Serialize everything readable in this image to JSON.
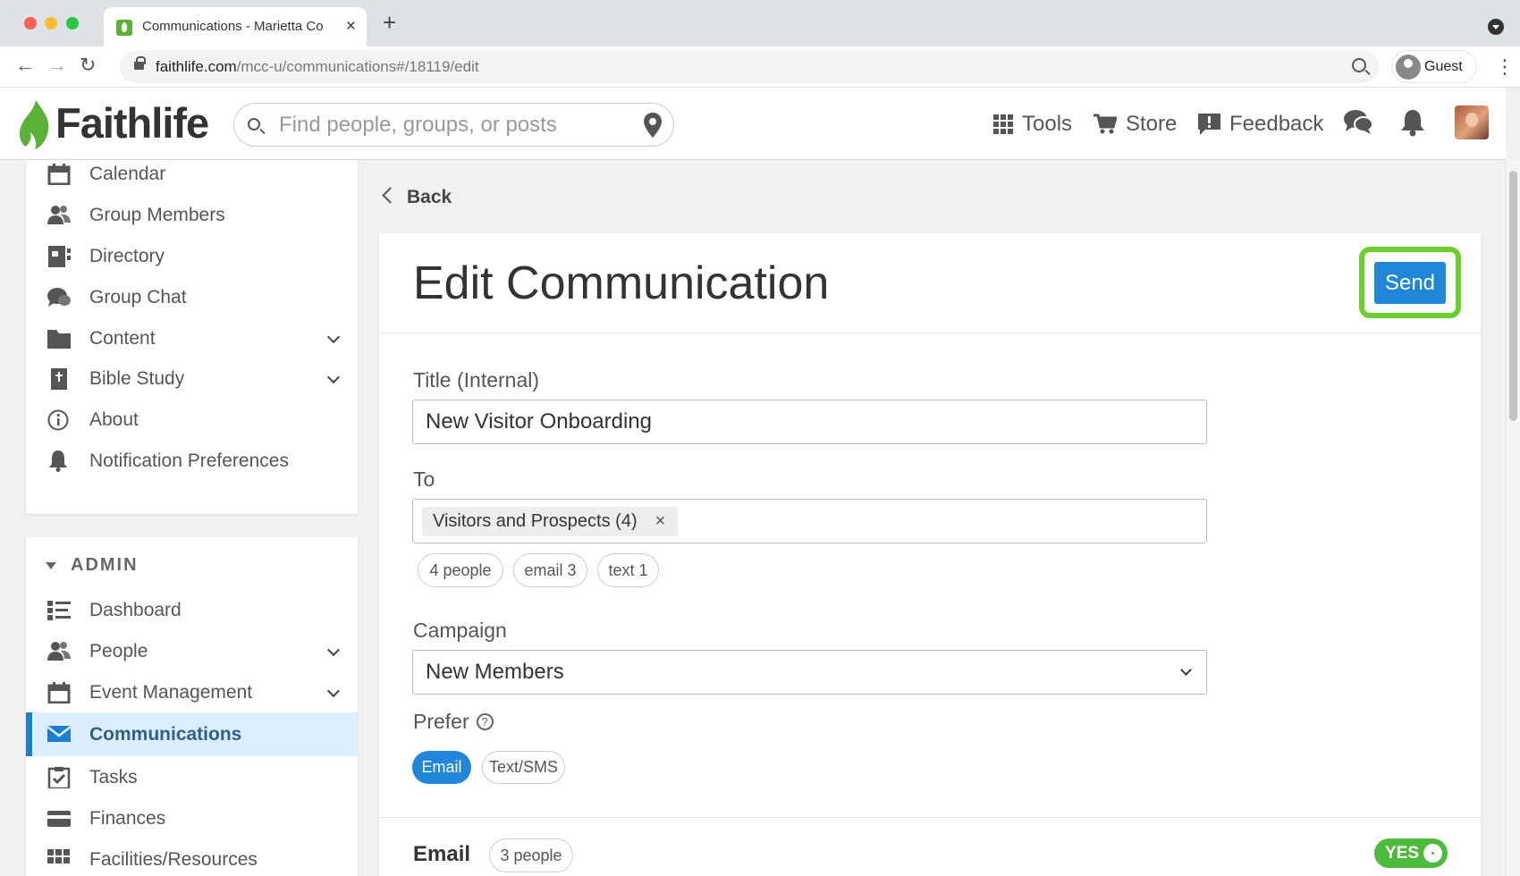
{
  "browser": {
    "tab_title": "Communications - Marietta Co",
    "tab_close": "×",
    "new_tab": "+",
    "url_host": "faithlife.com",
    "url_path": "/mcc-u/communications#/18119/edit",
    "profile_label": "Guest"
  },
  "header": {
    "logo_text": "Faithlife",
    "search_placeholder": "Find people, groups, or posts",
    "nav": {
      "tools": "Tools",
      "store": "Store",
      "feedback": "Feedback"
    }
  },
  "sidebar": {
    "items": [
      {
        "label": "Calendar",
        "icon": "calendar-icon"
      },
      {
        "label": "Group Members",
        "icon": "people-icon"
      },
      {
        "label": "Directory",
        "icon": "directory-icon"
      },
      {
        "label": "Group Chat",
        "icon": "chat-icon"
      },
      {
        "label": "Content",
        "icon": "folder-icon"
      },
      {
        "label": "Bible Study",
        "icon": "bible-icon"
      },
      {
        "label": "About",
        "icon": "info-icon"
      },
      {
        "label": "Notification Preferences",
        "icon": "bell-icon"
      }
    ],
    "admin_heading": "ADMIN",
    "admin_items": [
      {
        "label": "Dashboard",
        "icon": "dashboard-icon"
      },
      {
        "label": "People",
        "icon": "people-icon"
      },
      {
        "label": "Event Management",
        "icon": "calendar-icon"
      },
      {
        "label": "Communications",
        "icon": "envelope-icon"
      },
      {
        "label": "Tasks",
        "icon": "tasks-icon"
      },
      {
        "label": "Finances",
        "icon": "card-icon"
      },
      {
        "label": "Facilities/Resources",
        "icon": "grid-icon"
      }
    ]
  },
  "main": {
    "back_label": "Back",
    "title": "Edit Communication",
    "send_label": "Send",
    "title_field": {
      "label": "Title (Internal)",
      "value": "New Visitor Onboarding"
    },
    "to_field": {
      "label": "To",
      "recipient": "Visitors and Prospects (4)",
      "remove": "×",
      "counts": [
        "4 people",
        "email 3",
        "text 1"
      ]
    },
    "campaign": {
      "label": "Campaign",
      "value": "New Members"
    },
    "prefer": {
      "label": "Prefer",
      "help": "?",
      "options": [
        "Email",
        "Text/SMS"
      ],
      "selected": "Email"
    },
    "email_section": {
      "title": "Email",
      "count": "3 people",
      "toggle": "YES"
    }
  },
  "colors": {
    "accent": "#1f86d8",
    "highlight": "#6ad02e",
    "toggle_on": "#4cbb3a",
    "brand_green": "#5bb135"
  }
}
